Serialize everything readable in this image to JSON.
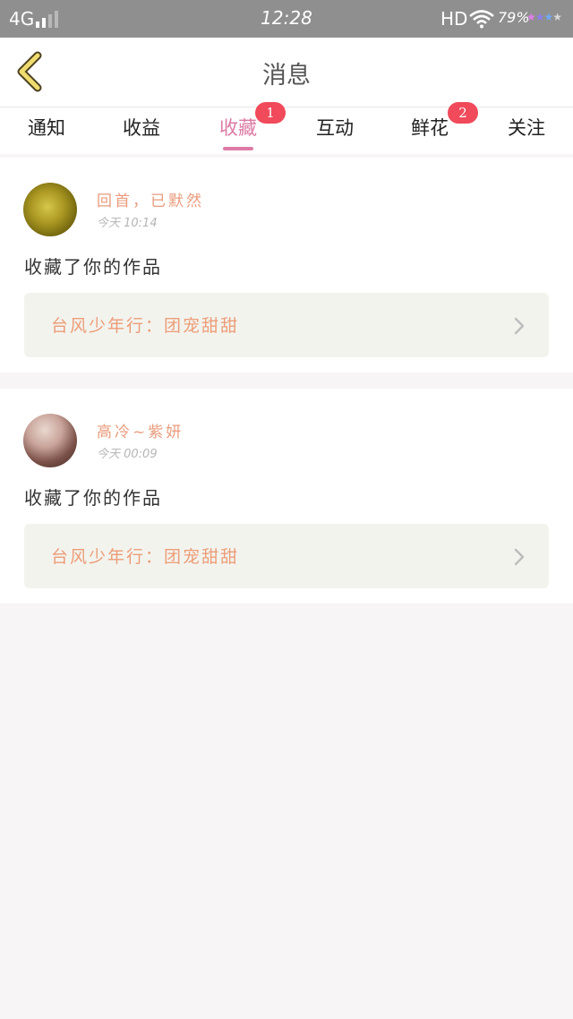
{
  "status_bar": {
    "network": "4G",
    "time": "12:28",
    "hd": "HD",
    "battery": "79%"
  },
  "header": {
    "title": "消息"
  },
  "tabs": [
    {
      "label": "通知",
      "badge": ""
    },
    {
      "label": "收益",
      "badge": ""
    },
    {
      "label": "收藏",
      "badge": "1",
      "active": true
    },
    {
      "label": "互动",
      "badge": ""
    },
    {
      "label": "鲜花",
      "badge": "2"
    },
    {
      "label": "关注",
      "badge": ""
    }
  ],
  "messages": [
    {
      "username": "回首，已默然",
      "time": "今天 10:14",
      "action": "收藏了你的作品",
      "work_title": "台风少年行：团宠甜甜"
    },
    {
      "username": "高冷~紫妍",
      "time": "今天 00:09",
      "action": "收藏了你的作品",
      "work_title": "台风少年行：团宠甜甜"
    }
  ],
  "colors": {
    "accent": "#dd7aa5",
    "badge": "#f04a5b",
    "name": "#e99b7c"
  }
}
